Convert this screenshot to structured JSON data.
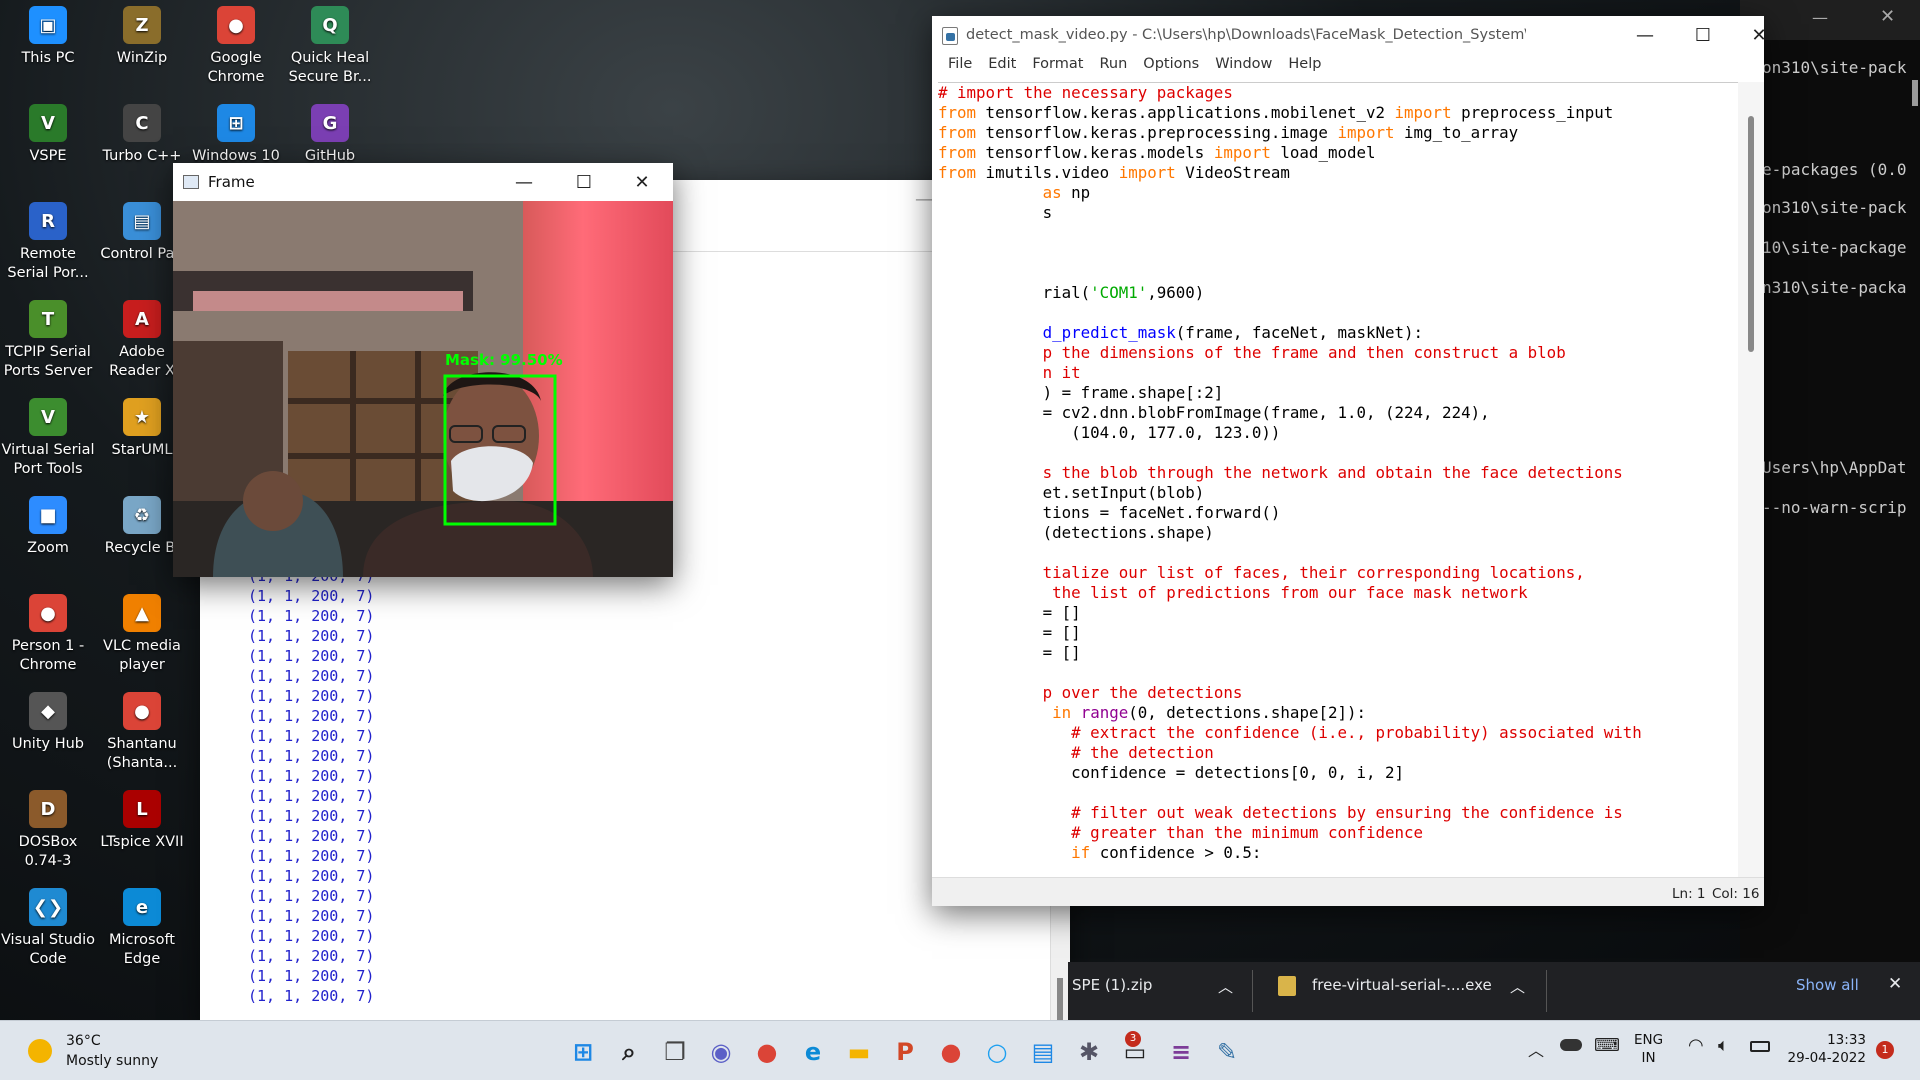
{
  "desktop": {
    "icons": [
      {
        "label": "This PC",
        "color": "#1e90ff",
        "glyph": "▣"
      },
      {
        "label": "WinZip",
        "color": "#8a6d2b",
        "glyph": "Z"
      },
      {
        "label": "Google Chrome",
        "color": "#db4437",
        "glyph": "●"
      },
      {
        "label": "Quick Heal Secure Br...",
        "color": "#2e8b57",
        "glyph": "Q"
      },
      {
        "label": "VSPE",
        "color": "#2a7a2a",
        "glyph": "V"
      },
      {
        "label": "Turbo C++",
        "color": "#444",
        "glyph": "C"
      },
      {
        "label": "Windows 10",
        "color": "#1e88e5",
        "glyph": "⊞"
      },
      {
        "label": "GitHub",
        "color": "#7b3fb3",
        "glyph": "G"
      },
      {
        "label": "Remote Serial Por...",
        "color": "#2a62c9",
        "glyph": "R"
      },
      {
        "label": "Control Pan",
        "color": "#3a8fd8",
        "glyph": "▤"
      },
      {
        "label": "TCPIP Serial Ports Server",
        "color": "#4a8f2a",
        "glyph": "T"
      },
      {
        "label": "Adobe Reader X",
        "color": "#c81e1e",
        "glyph": "A"
      },
      {
        "label": "Virtual Serial Port Tools",
        "color": "#3c8d2f",
        "glyph": "V"
      },
      {
        "label": "StarUML",
        "color": "#e0a020",
        "glyph": "★"
      },
      {
        "label": "Zoom",
        "color": "#2d8cff",
        "glyph": "■"
      },
      {
        "label": "Recycle Bi",
        "color": "#7aa7c7",
        "glyph": "♻"
      },
      {
        "label": "Person 1 - Chrome",
        "color": "#db4437",
        "glyph": "●"
      },
      {
        "label": "VLC media player",
        "color": "#f08000",
        "glyph": "▲"
      },
      {
        "label": "Unity Hub",
        "color": "#555",
        "glyph": "◆"
      },
      {
        "label": "Shantanu (Shanta...",
        "color": "#db4437",
        "glyph": "●"
      },
      {
        "label": "DOSBox 0.74-3",
        "color": "#8b5a2b",
        "glyph": "D"
      },
      {
        "label": "LTspice XVII",
        "color": "#a00",
        "glyph": "L"
      },
      {
        "label": "Visual Studio Code",
        "color": "#1f8ad2",
        "glyph": "❮❯"
      },
      {
        "label": "Microsoft Edge",
        "color": "#0c8ad6",
        "glyph": "e"
      }
    ]
  },
  "terminal_bg": {
    "lines": [
      "on310\\site-pack",
      "e-packages (0.0",
      "on310\\site-pack",
      "10\\site-package",
      "n310\\site-packa",
      "Users\\hp\\AppDat",
      "--no-warn-scrip"
    ]
  },
  "shell": {
    "row": "(1, 1, 200, 7)",
    "rows": [
      "(1, 1, 200, 7)",
      "(1, 1, 200, 7)",
      "(1, 1, 200, 7)",
      "(1, 1, 200, 7)",
      "(1, 1, 200, 7)",
      "(1, 1, 200, 7)",
      "(1, 1, 200, 7)",
      "(1, 1, 200, 7)",
      "(1, 1, 200, 7)",
      "(1, 1, 200, 7)",
      "(1, 1, 200, 7)",
      "(1, 1, 200, 7)",
      "(1, 1, 200, 7)",
      "(1, 1, 200, 7)",
      "(1, 1, 200, 7)",
      "(1, 1, 200, 7)",
      "(1, 1, 200, 7)",
      "(1, 1, 200, 7)",
      "(1, 1, 200, 7)",
      "(1, 1, 200, 7)",
      "(1, 1, 200, 7)",
      "(1, 1, 200, 7)"
    ]
  },
  "frame": {
    "title": "Frame",
    "label": "Mask: 99.50%"
  },
  "editor": {
    "title": "detect_mask_video.py - C:\\Users\\hp\\Downloads\\FaceMask_Detection_System\\Face-Mask-De...",
    "menu": [
      "File",
      "Edit",
      "Format",
      "Run",
      "Options",
      "Window",
      "Help"
    ],
    "lines": [
      [
        [
          "# import the necessary packages",
          "c"
        ]
      ],
      [
        [
          "from",
          "k"
        ],
        [
          " tensorflow.keras.applications.mobilenet_v2 ",
          "t"
        ],
        [
          "import",
          "k"
        ],
        [
          " preprocess_input",
          "t"
        ]
      ],
      [
        [
          "from",
          "k"
        ],
        [
          " tensorflow.keras.preprocessing.image ",
          "t"
        ],
        [
          "import",
          "k"
        ],
        [
          " img_to_array",
          "t"
        ]
      ],
      [
        [
          "from",
          "k"
        ],
        [
          " tensorflow.keras.models ",
          "t"
        ],
        [
          "import",
          "k"
        ],
        [
          " load_model",
          "t"
        ]
      ],
      [
        [
          "from",
          "k"
        ],
        [
          " imutils.video ",
          "t"
        ],
        [
          "import",
          "k"
        ],
        [
          " VideoStream",
          "t"
        ]
      ],
      [
        [
          "           ",
          "t"
        ],
        [
          "as",
          "k"
        ],
        [
          " np",
          "t"
        ]
      ],
      [
        [
          "           s",
          "t"
        ]
      ],
      [
        [
          "",
          "t"
        ]
      ],
      [
        [
          "",
          "t"
        ]
      ],
      [
        [
          "",
          "t"
        ]
      ],
      [
        [
          "           rial(",
          "t"
        ],
        [
          "'COM1'",
          "s"
        ],
        [
          ",9600)",
          "t"
        ]
      ],
      [
        [
          "",
          "t"
        ]
      ],
      [
        [
          "           ",
          "t"
        ],
        [
          "d_predict_mask",
          "f"
        ],
        [
          "(frame, faceNet, maskNet):",
          "t"
        ]
      ],
      [
        [
          "           ",
          "t"
        ],
        [
          "p the dimensions of the frame and then construct a blob",
          "c"
        ]
      ],
      [
        [
          "           ",
          "t"
        ],
        [
          "n it",
          "c"
        ]
      ],
      [
        [
          "           ) = frame.shape[:2]",
          "t"
        ]
      ],
      [
        [
          "           = cv2.dnn.blobFromImage(frame, 1.0, (224, 224),",
          "t"
        ]
      ],
      [
        [
          "              (104.0, 177.0, 123.0))",
          "t"
        ]
      ],
      [
        [
          "",
          "t"
        ]
      ],
      [
        [
          "           ",
          "t"
        ],
        [
          "s the blob through the network and obtain the face detections",
          "c"
        ]
      ],
      [
        [
          "           et.setInput(blob)",
          "t"
        ]
      ],
      [
        [
          "           tions = faceNet.forward()",
          "t"
        ]
      ],
      [
        [
          "           (detections.shape)",
          "t"
        ]
      ],
      [
        [
          "",
          "t"
        ]
      ],
      [
        [
          "           ",
          "t"
        ],
        [
          "tialize our list of faces, their corresponding locations,",
          "c"
        ]
      ],
      [
        [
          "           ",
          "t"
        ],
        [
          " the list of predictions from our face mask network",
          "c"
        ]
      ],
      [
        [
          "           = []",
          "t"
        ]
      ],
      [
        [
          "           = []",
          "t"
        ]
      ],
      [
        [
          "           = []",
          "t"
        ]
      ],
      [
        [
          "",
          "t"
        ]
      ],
      [
        [
          "           ",
          "t"
        ],
        [
          "p over the detections",
          "c"
        ]
      ],
      [
        [
          "            ",
          "t"
        ],
        [
          "in",
          "k"
        ],
        [
          " ",
          "t"
        ],
        [
          "range",
          "b"
        ],
        [
          "(0, detections.shape[2]):",
          "t"
        ]
      ],
      [
        [
          "              ",
          "t"
        ],
        [
          "# extract the confidence (i.e., probability) associated with",
          "c"
        ]
      ],
      [
        [
          "              ",
          "t"
        ],
        [
          "# the detection",
          "c"
        ]
      ],
      [
        [
          "              confidence = detections[0, 0, i, 2]",
          "t"
        ]
      ],
      [
        [
          "",
          "t"
        ]
      ],
      [
        [
          "              ",
          "t"
        ],
        [
          "# filter out weak detections by ensuring the confidence is",
          "c"
        ]
      ],
      [
        [
          "              ",
          "t"
        ],
        [
          "# greater than the minimum confidence",
          "c"
        ]
      ],
      [
        [
          "              ",
          "t"
        ],
        [
          "if",
          "k"
        ],
        [
          " confidence > 0.5:",
          "t"
        ]
      ]
    ],
    "status_ln": "Ln: 1",
    "status_col": "Col: 16"
  },
  "downloads": {
    "item1": "SPE (1).zip",
    "item2": "free-virtual-serial-....exe",
    "show_all": "Show all"
  },
  "weather": {
    "temp": "36°C",
    "desc": "Mostly sunny"
  },
  "tray": {
    "lang1": "ENG",
    "lang2": "IN",
    "time": "13:33",
    "date": "29-04-2022",
    "notif": "1",
    "teams_badge": "3"
  },
  "colors": {
    "taskbar": "#dfe5ec",
    "keyword": "#ff7700",
    "comment": "#dd0000",
    "string": "#00aa00",
    "func": "#0000ff",
    "builtin": "#900090",
    "shell_text": "#2222cc"
  }
}
